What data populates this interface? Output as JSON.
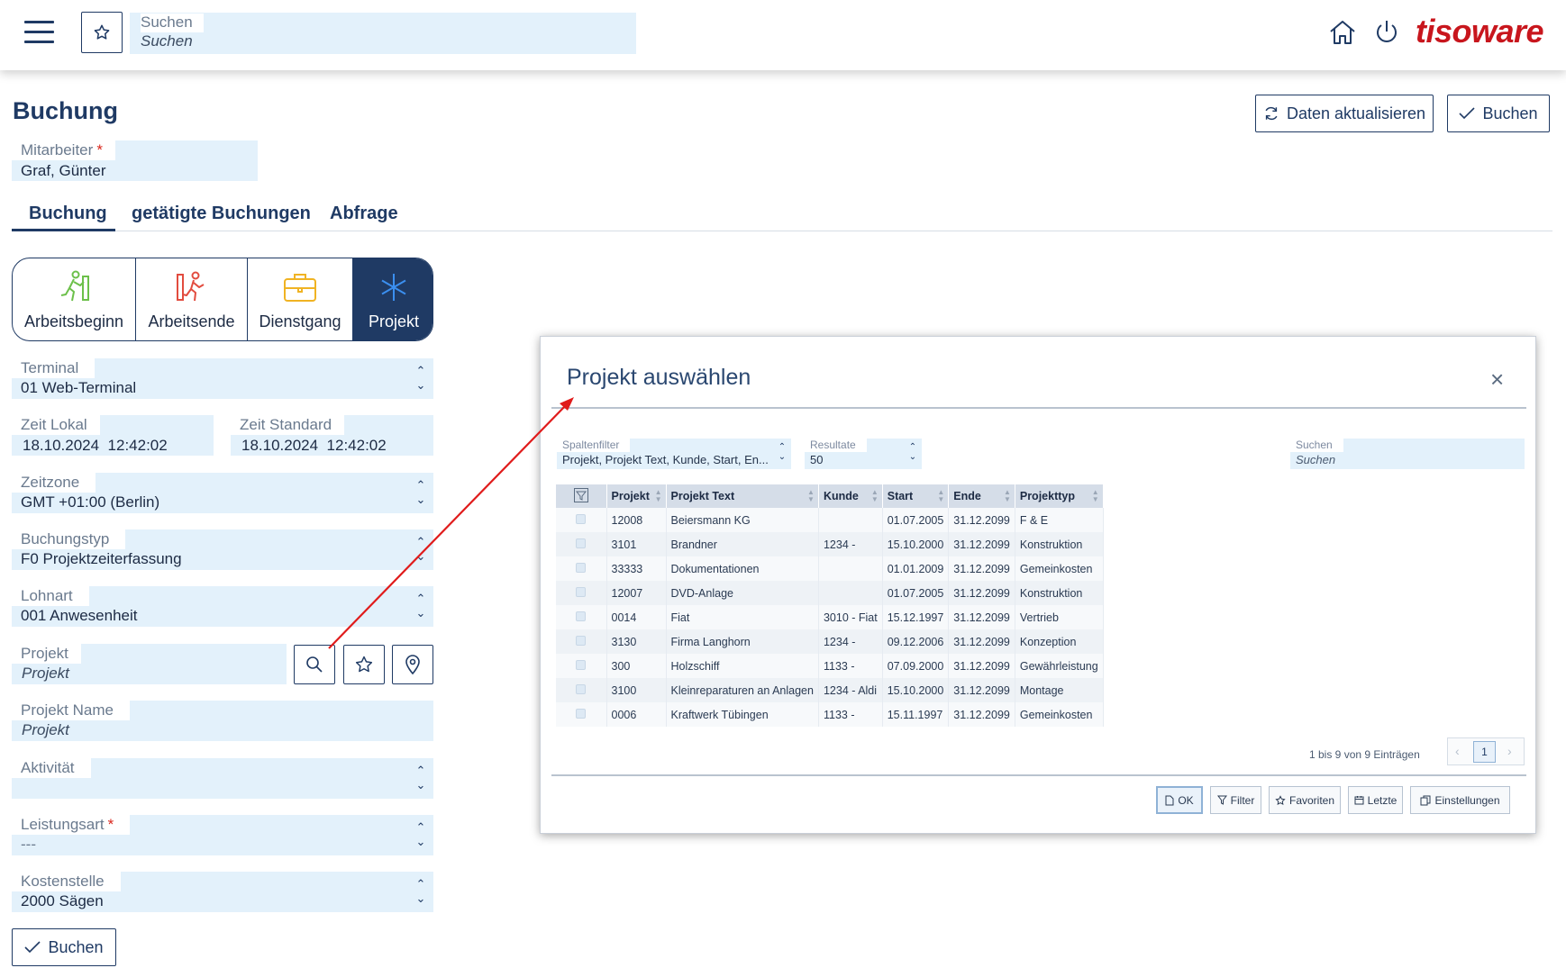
{
  "topbar": {
    "search_label": "Suchen",
    "search_placeholder": "Suchen",
    "brand": "tisoware",
    "icons": [
      "menu-icon",
      "star-icon",
      "home-icon",
      "power-icon"
    ]
  },
  "page": {
    "title": "Buchung",
    "refresh_button": "Daten aktualisieren",
    "book_button_top": "Buchen",
    "book_button_bottom": "Buchen"
  },
  "employee": {
    "label": "Mitarbeiter",
    "required": "*",
    "value": "Graf, Günter"
  },
  "tabs": [
    {
      "label": "Buchung",
      "active": true
    },
    {
      "label": "getätigte Buchungen",
      "active": false
    },
    {
      "label": "Abfrage",
      "active": false
    }
  ],
  "booking_types": [
    {
      "label": "Arbeitsbeginn",
      "icon": "walk-in-icon",
      "color": "#6cc04a"
    },
    {
      "label": "Arbeitsende",
      "icon": "walk-out-icon",
      "color": "#e24c3f"
    },
    {
      "label": "Dienstgang",
      "icon": "briefcase-icon",
      "color": "#f0b323"
    },
    {
      "label": "Projekt",
      "icon": "asterisk-icon",
      "color": "#2b7de0",
      "selected": true
    }
  ],
  "form": {
    "terminal": {
      "label": "Terminal",
      "value": "01 Web-Terminal"
    },
    "zeit_lokal": {
      "label": "Zeit Lokal",
      "value": "18.10.2024  12:42:02"
    },
    "zeit_standard": {
      "label": "Zeit Standard",
      "value": "18.10.2024  12:42:02"
    },
    "zeitzone": {
      "label": "Zeitzone",
      "value": "GMT +01:00 (Berlin)"
    },
    "buchungstyp": {
      "label": "Buchungstyp",
      "value": "F0 Projektzeiterfassung"
    },
    "lohnart": {
      "label": "Lohnart",
      "value": "001 Anwesenheit"
    },
    "projekt": {
      "label": "Projekt",
      "placeholder": "Projekt"
    },
    "projekt_name": {
      "label": "Projekt Name",
      "placeholder": "Projekt"
    },
    "aktivitaet": {
      "label": "Aktivität",
      "value": ""
    },
    "leistungsart": {
      "label": "Leistungsart",
      "required": "*",
      "value": "---"
    },
    "kostenstelle": {
      "label": "Kostenstelle",
      "value": "2000 Sägen"
    }
  },
  "dialog": {
    "title": "Projekt auswählen",
    "close": "×",
    "spaltenfilter": {
      "label": "Spaltenfilter",
      "value": "Projekt, Projekt Text, Kunde, Start, En..."
    },
    "resultate": {
      "label": "Resultate",
      "value": "50"
    },
    "suchen": {
      "label": "Suchen",
      "placeholder": "Suchen"
    },
    "columns": [
      "Projekt",
      "Projekt Text",
      "Kunde",
      "Start",
      "Ende",
      "Projekttyp"
    ],
    "rows": [
      [
        "12008",
        "Beiersmann KG",
        "",
        "01.07.2005",
        "31.12.2099",
        "F & E"
      ],
      [
        "3101",
        "Brandner",
        "1234 -",
        "15.10.2000",
        "31.12.2099",
        "Konstruktion"
      ],
      [
        "33333",
        "Dokumentationen",
        "",
        "01.01.2009",
        "31.12.2099",
        "Gemeinkosten"
      ],
      [
        "12007",
        "DVD-Anlage",
        "",
        "01.07.2005",
        "31.12.2099",
        "Konstruktion"
      ],
      [
        "0014",
        "Fiat",
        "3010 - Fiat",
        "15.12.1997",
        "31.12.2099",
        "Vertrieb"
      ],
      [
        "3130",
        "Firma Langhorn",
        "1234 -",
        "09.12.2006",
        "31.12.2099",
        "Konzeption"
      ],
      [
        "300",
        "Holzschiff",
        "1133 -",
        "07.09.2000",
        "31.12.2099",
        "Gewährleistung"
      ],
      [
        "3100",
        "Kleinreparaturen an Anlagen",
        "1234 - Aldi",
        "15.10.2000",
        "31.12.2099",
        "Montage"
      ],
      [
        "0006",
        "Kraftwerk Tübingen",
        "1133 -",
        "15.11.1997",
        "31.12.2099",
        "Gemeinkosten"
      ]
    ],
    "pagination": {
      "info": "1 bis 9 von 9 Einträgen",
      "page": "1",
      "prev": "‹",
      "next": "›"
    },
    "buttons": {
      "ok": "OK",
      "filter": "Filter",
      "favoriten": "Favoriten",
      "letzte": "Letzte",
      "einstellungen": "Einstellungen"
    }
  },
  "colors": {
    "primary": "#1f3a64",
    "field_bg": "#e3f1fb",
    "brand_red": "#c8161d",
    "arrow": "#e01b1b"
  }
}
